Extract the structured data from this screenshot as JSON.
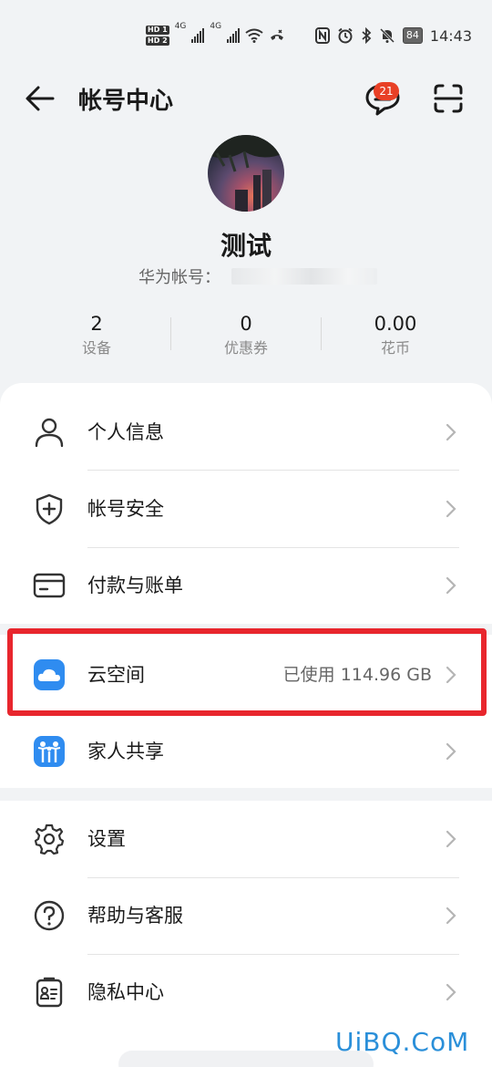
{
  "status_bar": {
    "hd1": "HD 1",
    "hd2": "HD 2",
    "net1": "4G",
    "net2": "4G",
    "battery": "84",
    "time": "14:43"
  },
  "header": {
    "title": "帐号中心",
    "badge_count": "21"
  },
  "profile": {
    "name": "测试",
    "account_label": "华为帐号："
  },
  "stats": [
    {
      "value": "2",
      "label": "设备"
    },
    {
      "value": "0",
      "label": "优惠券"
    },
    {
      "value": "0.00",
      "label": "花币"
    }
  ],
  "menu_group1": [
    {
      "label": "个人信息",
      "icon": "person-icon"
    },
    {
      "label": "帐号安全",
      "icon": "shield-icon"
    },
    {
      "label": "付款与账单",
      "icon": "card-icon"
    }
  ],
  "menu_group2": [
    {
      "label": "云空间",
      "value": "已使用 114.96 GB",
      "icon": "cloud-icon"
    },
    {
      "label": "家人共享",
      "icon": "family-icon"
    }
  ],
  "menu_group3": [
    {
      "label": "设置",
      "icon": "gear-icon"
    },
    {
      "label": "帮助与客服",
      "icon": "help-icon"
    },
    {
      "label": "隐私中心",
      "icon": "privacy-icon"
    }
  ],
  "watermark": "UiBQ.CoM",
  "colors": {
    "highlight": "#e8262d",
    "badge": "#e84026",
    "cloud_blue": "#2f8cf0"
  }
}
